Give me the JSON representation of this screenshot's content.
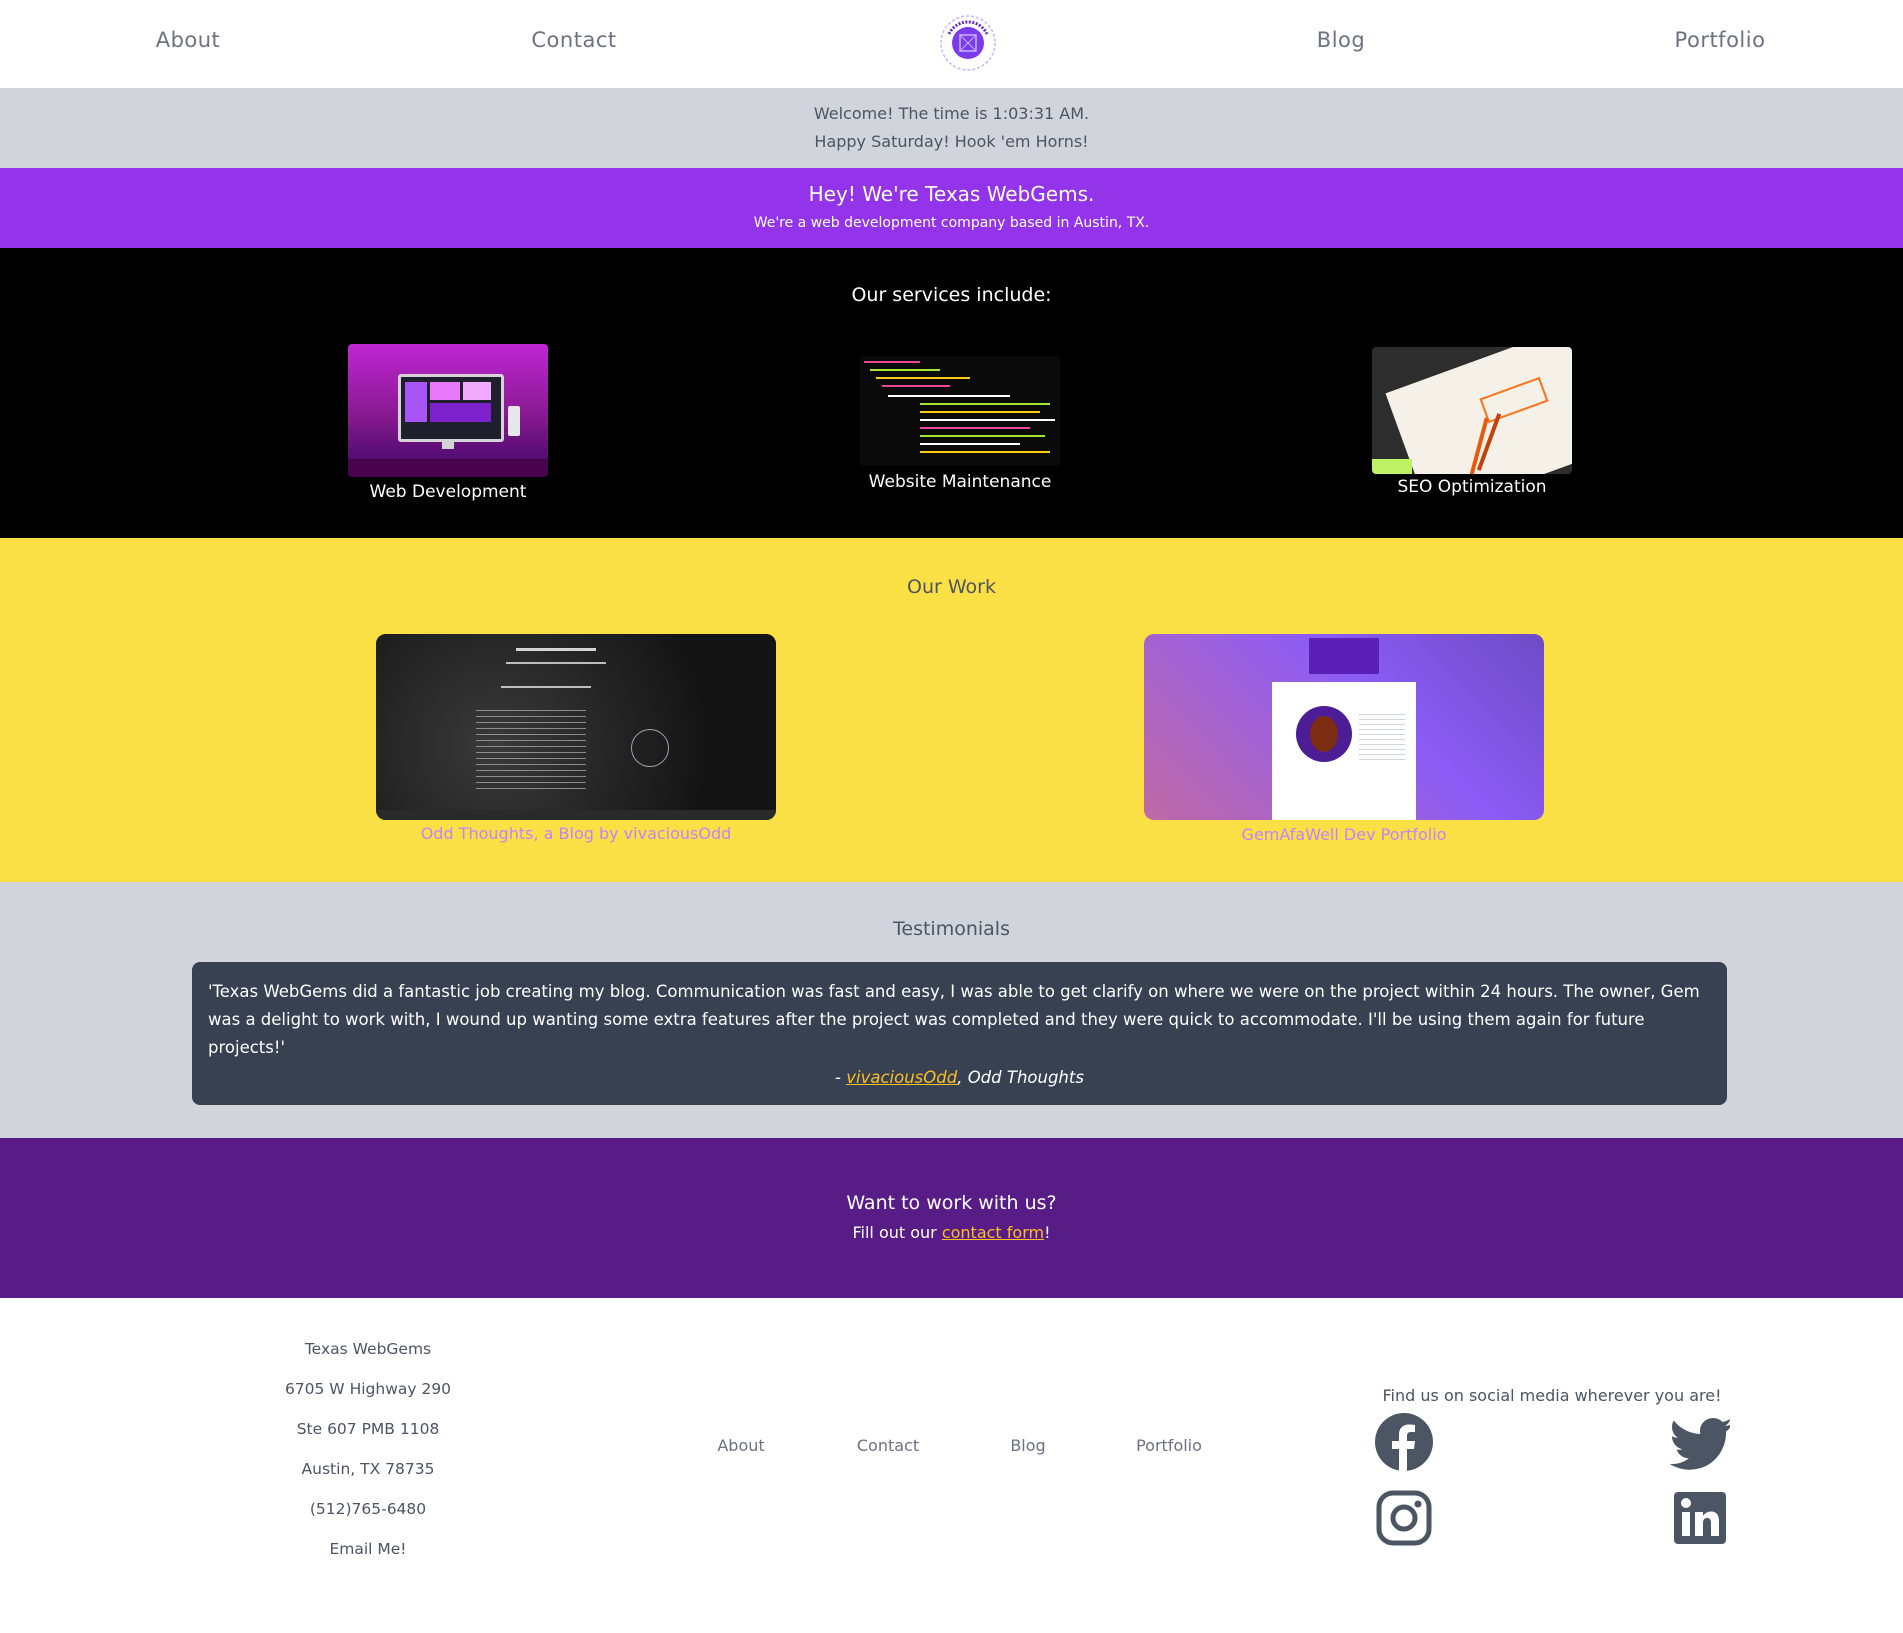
{
  "nav": {
    "left_links": [
      "About",
      "Contact"
    ],
    "right_links": [
      "Blog",
      "Portfolio"
    ],
    "logo_text": "Texas WebGems",
    "colors": {
      "logo_ring": "#a78bfa",
      "logo_center": "#7c3aed"
    }
  },
  "welcome": {
    "time_line": "Welcome! The time is 1:03:31 AM.",
    "greeting_line": "Happy Saturday! Hook 'em Horns!"
  },
  "hero": {
    "heading": "Hey! We're Texas WebGems.",
    "subheading": "We're a web development company based in Austin, TX."
  },
  "services": {
    "title": "Our services include:",
    "items": [
      {
        "label": "Web Development"
      },
      {
        "label": "Website Maintenance"
      },
      {
        "label": "SEO Optimization"
      }
    ]
  },
  "work": {
    "title": "Our Work",
    "items": [
      {
        "label": "Odd Thoughts, a Blog by vivaciousOdd"
      },
      {
        "label": "GemAfaWell Dev Portfolio"
      }
    ]
  },
  "testimonials": {
    "title": "Testimonials",
    "quote": "'Texas WebGems did a fantastic job creating my blog. Communication was fast and easy, I was able to get clarify on where we were on the project within 24 hours. The owner, Gem was a delight to work with, I wound up wanting some extra features after the project was completed and they were quick to accommodate. I'll be using them again for future projects!'",
    "author_prefix": "- ",
    "author_name": "vivaciousOdd",
    "author_suffix": ", Odd Thoughts"
  },
  "cta": {
    "heading": "Want to work with us?",
    "text_before": "Fill out our ",
    "link_text": "contact form",
    "text_after": "!"
  },
  "footer": {
    "address": [
      "Texas WebGems",
      "6705 W Highway 290",
      "Ste 607 PMB 1108",
      "Austin, TX 78735",
      "(512)765-6480",
      "Email Me!"
    ],
    "links": [
      "About",
      "Contact",
      "Blog",
      "Portfolio"
    ],
    "social_text": "Find us on social media wherever you are!",
    "social": [
      "facebook-icon",
      "twitter-icon",
      "instagram-icon",
      "linkedin-icon"
    ]
  },
  "colors": {
    "purple": "#9333ea",
    "dark_purple": "#581c87",
    "yellow": "#fbe045",
    "gray": "#d1d5db",
    "slate": "#374151"
  }
}
